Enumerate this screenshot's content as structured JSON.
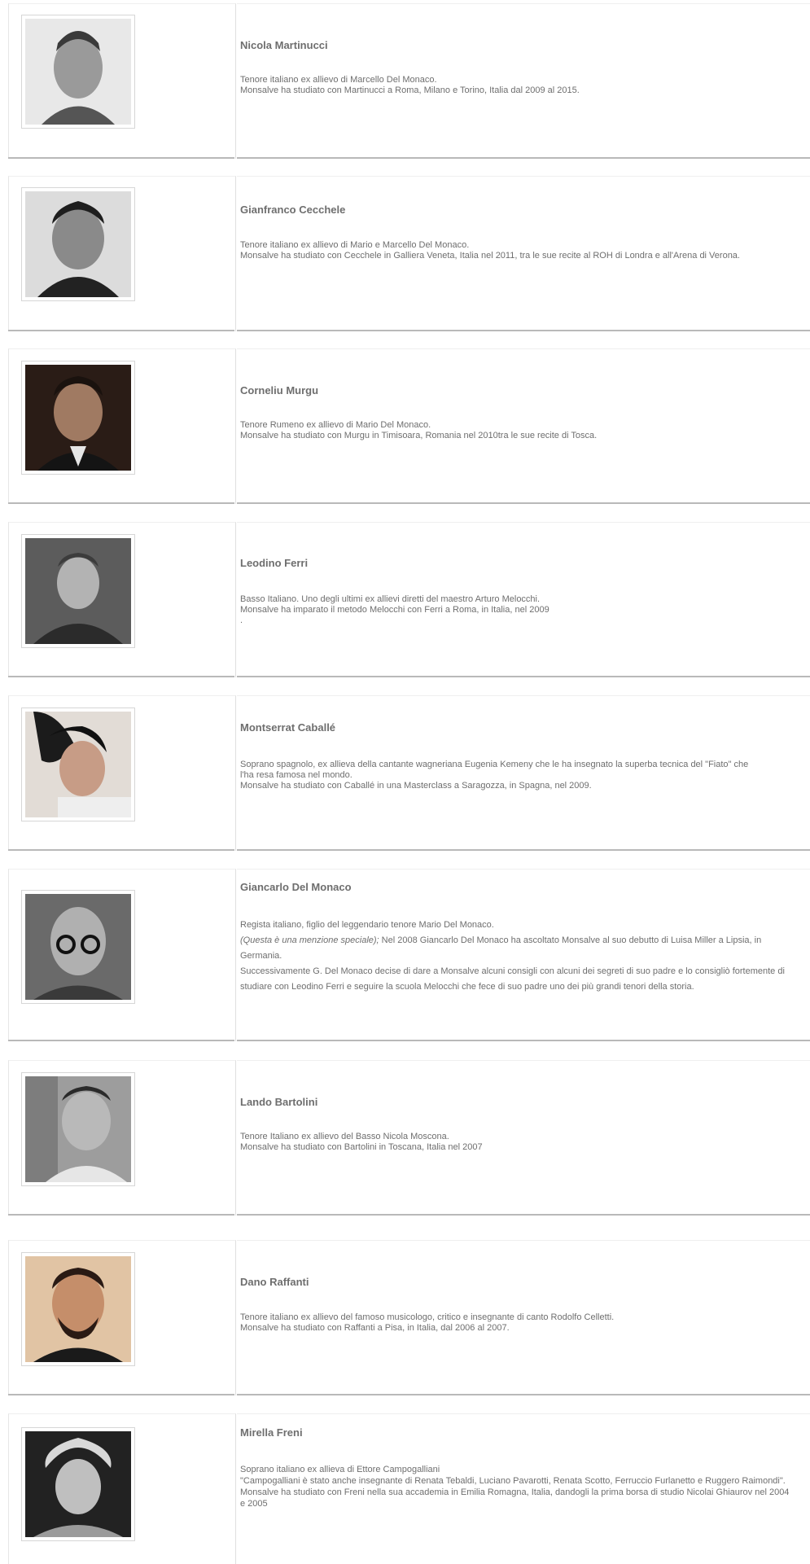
{
  "teachers": [
    {
      "name": "Nicola Martinucci",
      "lines": [
        "Tenore italiano ex allievo di Marcello Del Monaco.",
        "Monsalve ha studiato con Martinucci a Roma, Milano e Torino, Italia dal 2009 al 2015."
      ],
      "photo_tone": "#b9b9b9"
    },
    {
      "name": "Gianfranco Cecchele",
      "lines": [
        "Tenore italiano ex allievo di Mario  e Marcello Del Monaco.",
        "Monsalve ha studiato con Cecchele in Galliera Veneta, Italia nel 2011, tra le sue recite al ROH di Londra e all'Arena di Verona."
      ],
      "photo_tone": "#9a9a9a"
    },
    {
      "name": "Corneliu Murgu",
      "lines": [
        "Tenore Rumeno ex allievo di Mario Del Monaco.",
        "Monsalve ha studiato con Murgu in Timisoara, Romania nel 2010tra le sue recite di Tosca."
      ],
      "photo_tone": "#6b5040"
    },
    {
      "name": "Leodino Ferri",
      "lines": [
        "Basso Italiano. Uno degli ultimi ex allievi diretti del maestro Arturo Melocchi.",
        "Monsalve ha imparato il metodo Melocchi con Ferri a Roma, in Italia, nel 2009",
        "."
      ],
      "photo_tone": "#8c8c8c"
    },
    {
      "name": "Montserrat Caballé",
      "lines": [
        "Soprano spagnolo, ex allieva della cantante wagneriana Eugenia Kemeny che le ha insegnato la superba tecnica del \"Fiato\" che l'ha resa famosa nel mondo.",
        "Monsalve ha studiato con Caballé in una Masterclass a Saragozza, in Spagna, nel 2009."
      ],
      "photo_tone": "#9b7e6e"
    },
    {
      "name": "Giancarlo Del Monaco",
      "lines": [
        "Regista italiano, figlio del leggendario tenore Mario Del Monaco.",
        "Nel 2008 Giancarlo Del Monaco ha ascoltato Monsalve al suo debutto di Luisa Miller a Lipsia, in Germania.",
        "Successivamente G. Del Monaco decise di dare a Monsalve alcuni consigli con alcuni dei segreti di suo padre e lo consigliò fortemente di studiare con Leodino Ferri e seguire la scuola Melocchi che fece di suo padre uno dei più grandi tenori della storia."
      ],
      "italic_note": "(Questa è una menzione speciale);",
      "photo_tone": "#7a7a7a"
    },
    {
      "name": "Lando Bartolini",
      "lines": [
        "Tenore Italiano ex allievo del Basso Nicola Moscona.",
        "Monsalve ha studiato con Bartolini in Toscana, Italia  nel 2007"
      ],
      "photo_tone": "#a8a8a8"
    },
    {
      "name": "Dano Raffanti",
      "lines": [
        "Tenore italiano ex allievo del famoso musicologo, critico e insegnante di canto Rodolfo Celletti.",
        "Monsalve ha studiato con Raffanti a Pisa, in Italia, dal 2006 al 2007."
      ],
      "photo_tone": "#c59a74"
    },
    {
      "name": "Mirella Freni",
      "lines": [
        "Soprano italiano ex allieva di Ettore Campogalliani",
        "\"Campogalliani è stato anche insegnante di Renata Tebaldi, Luciano Pavarotti, Renata Scotto, Ferruccio Furlanetto e Ruggero Raimondi\".",
        "Monsalve ha studiato con Freni nella sua accademia in Emilia Romagna, Italia, dandogli la prima borsa di studio Nicolai Ghiaurov nel 2004 e 2005"
      ],
      "photo_tone": "#8a8a8a"
    }
  ]
}
